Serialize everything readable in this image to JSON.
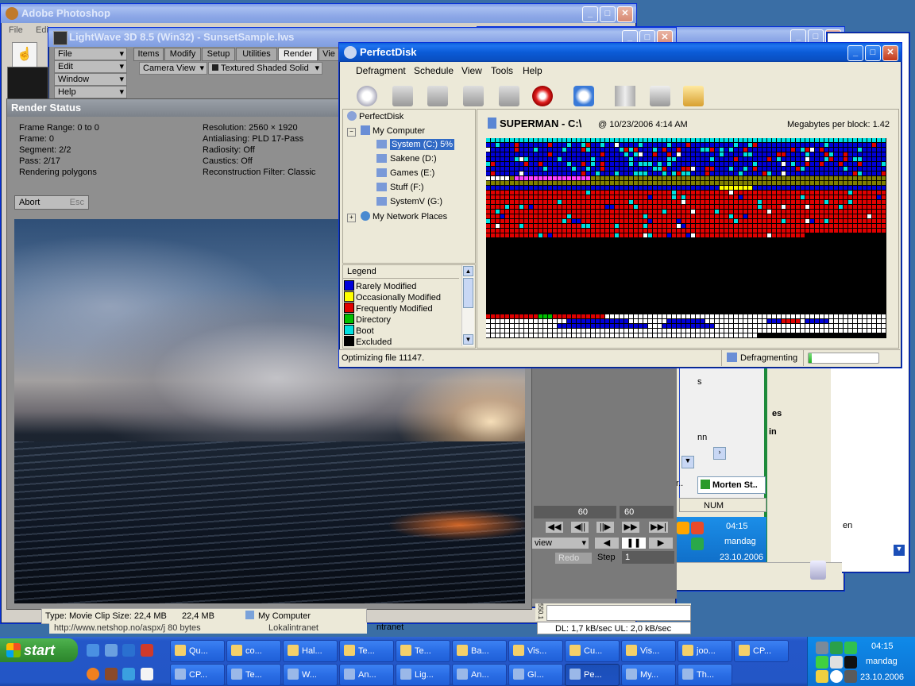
{
  "colors": {
    "xp_blue": "#0a5fd8",
    "lw_gray": "#8f8f8f",
    "disk_blue": "#0000d8",
    "disk_red": "#e00000",
    "disk_cyan": "#00e0e0",
    "disk_olive": "#808000",
    "disk_magenta": "#ff40ff",
    "disk_yellow": "#ffff00",
    "disk_green": "#00c000"
  },
  "photoshop": {
    "title": "Adobe Photoshop",
    "menu": [
      "File",
      "Edi"
    ]
  },
  "lightwave": {
    "title": "LightWave 3D 8.5 (Win32) - SunsetSample.lws",
    "left_buttons": [
      "File",
      "Edit",
      "Window",
      "Help"
    ],
    "tabs": [
      "Items",
      "Modify",
      "Setup",
      "Utilities",
      "Render",
      "Vie"
    ],
    "camera_view": "Camera View",
    "shading": "Textured Shaded Solid",
    "frame_slider_a": "60",
    "frame_slider_b": "60",
    "redo_label": "Redo",
    "step_label": "Step",
    "step_value": "1",
    "view_dropdown": "view"
  },
  "render_status": {
    "title": "Render Status",
    "left": [
      "Frame Range: 0 to 0",
      "Frame: 0",
      "Segment: 2/2",
      "Pass: 2/17",
      "Rendering polygons"
    ],
    "right": [
      "Resolution: 2560 × 1920",
      "Antialiasing: PLD 17-Pass",
      "Radiosity: Off",
      "Caustics: Off",
      "Reconstruction Filter: Classic"
    ],
    "abort_label": "Abort",
    "abort_key": "Esc"
  },
  "perfectdisk": {
    "title": "PerfectDisk",
    "menu": [
      "Defragment",
      "Schedule",
      "View",
      "Tools",
      "Help"
    ],
    "tree": {
      "root": "PerfectDisk",
      "my_computer": "My Computer",
      "drives": [
        "System (C:) 5%",
        "Sakene (D:)",
        "Games (E:)",
        "Stuff (F:)",
        "SystemV (G:)"
      ],
      "network": "My Network Places"
    },
    "legend_title": "Legend",
    "legend": [
      {
        "label": "Rarely Modified",
        "color": "#0000d8"
      },
      {
        "label": "Occasionally Modified",
        "color": "#ffff00"
      },
      {
        "label": "Frequently Modified",
        "color": "#e00000"
      },
      {
        "label": "Directory",
        "color": "#00c000"
      },
      {
        "label": "Boot",
        "color": "#00e0e0"
      },
      {
        "label": "Excluded",
        "color": "#000000"
      }
    ],
    "drive_header": "SUPERMAN - C:\\",
    "drive_date": "@ 10/23/2006 4:14 AM",
    "megabytes_per_block": "Megabytes per block: 1.42",
    "status_left": "Optimizing file 11147.",
    "status_right": "Defragmenting",
    "progress": 0.05
  },
  "explorer_bits": {
    "status_text": "Type: Movie Clip Size: 22,4 MB",
    "size": "22,4 MB",
    "location": "My Computer",
    "url": "http://www.netshop.no/aspx/j 80 bytes",
    "zone": "Lokalintranet",
    "intranet": "ntranet",
    "dl_ul": "DL: 1,7 kB/sec  UL: 2,0 kB/sec",
    "graph_label": "550.1"
  },
  "right_windows": {
    "tab_label": "Morten St..",
    "tab_prev": "tr..",
    "num": "NUM",
    "clock_time": "04:15",
    "clock_day": "mandag",
    "clock_date": "23.10.2006",
    "frag_s": "s",
    "frag_es": "es",
    "frag_in": "in",
    "frag_en": "en",
    "frag_nn": "nn"
  },
  "taskbar": {
    "start": "start",
    "row1": [
      "Qu...",
      "co...",
      "Hal...",
      "Te...",
      "Te...",
      "Ba...",
      "Vis...",
      "Cu...",
      "Vis...",
      "joo...",
      "CP..."
    ],
    "row2": [
      "CP...",
      "Te...",
      "W...",
      "An...",
      "Lig...",
      "An...",
      "GI...",
      "Pe...",
      "My...",
      "Th..."
    ],
    "clock_time": "04:15",
    "clock_day": "mandag",
    "clock_date": "23.10.2006"
  }
}
